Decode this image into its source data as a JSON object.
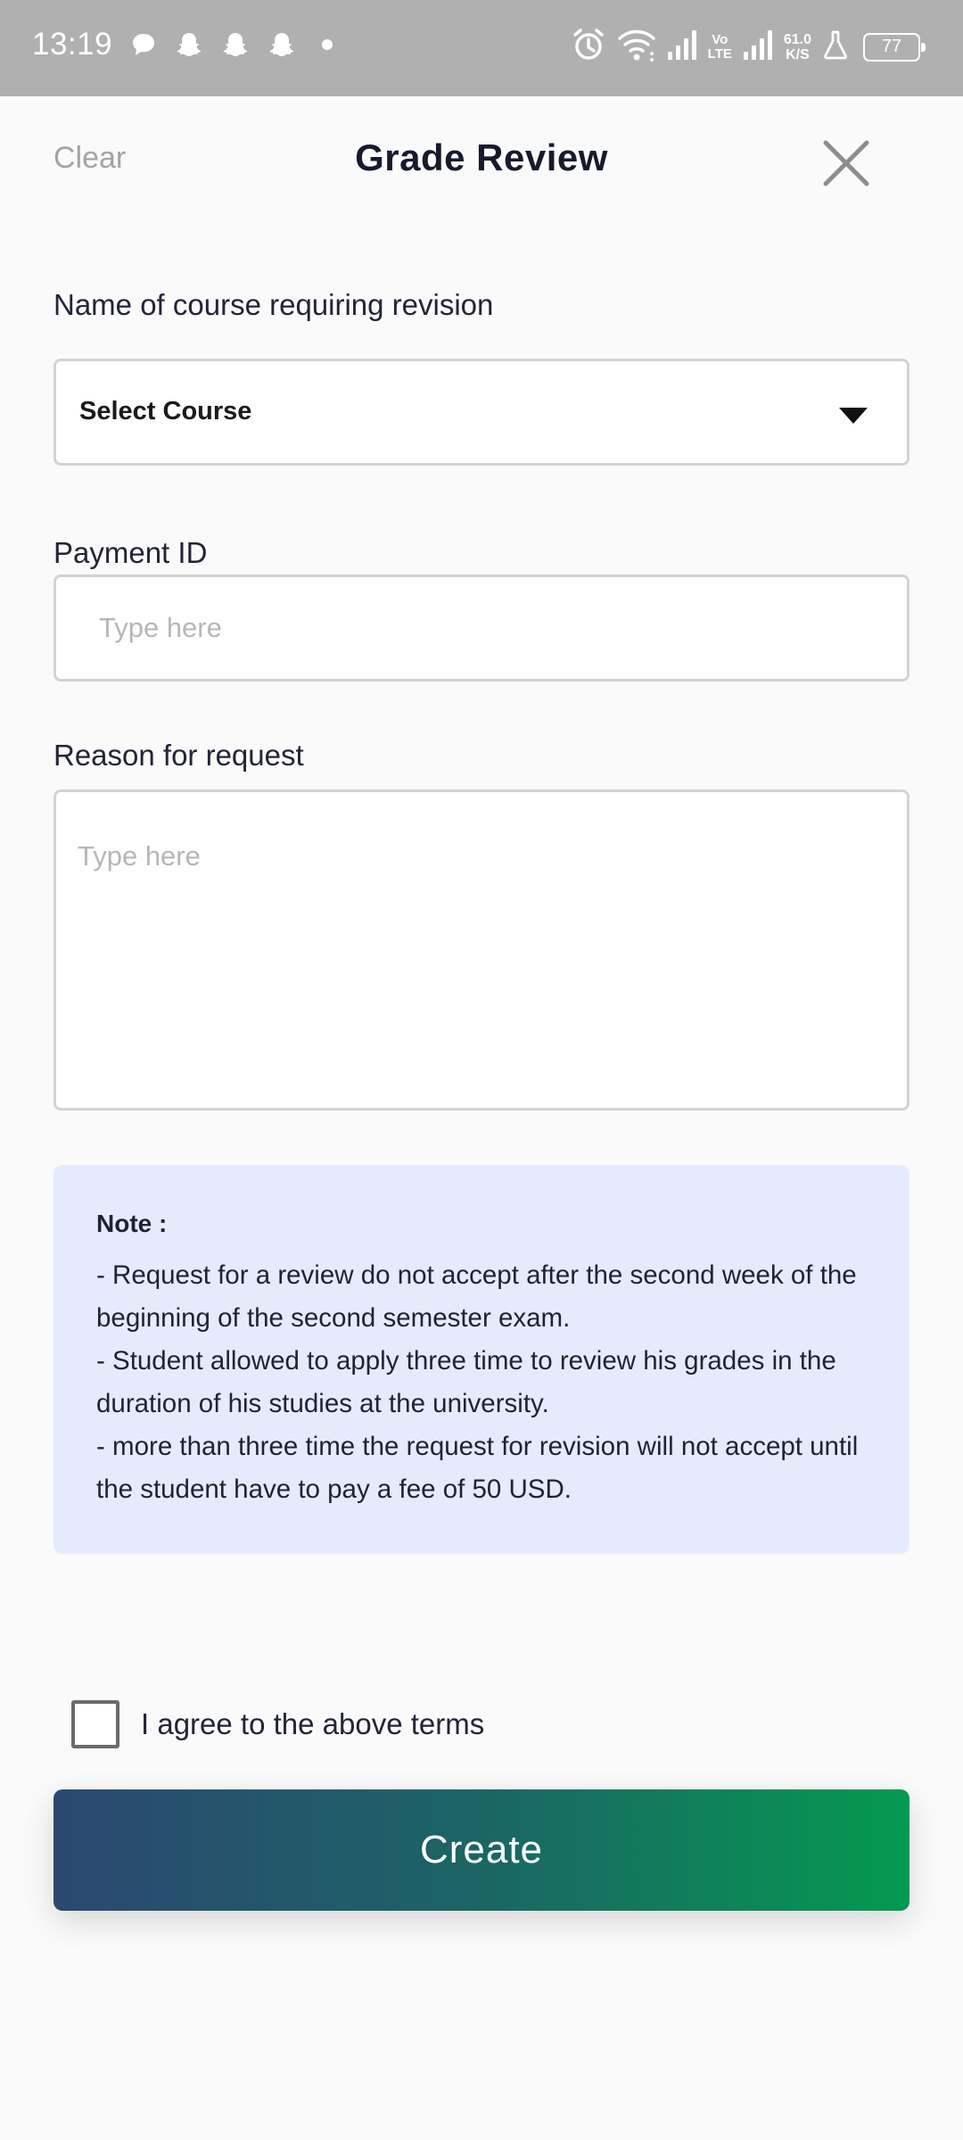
{
  "status_bar": {
    "time": "13:19",
    "left_icons": [
      "chat-bubble-icon",
      "snapchat-icon",
      "snapchat-icon",
      "snapchat-icon",
      "dot-icon"
    ],
    "lte_top": "Vo",
    "lte_bottom": "LTE",
    "net_speed_value": "61.0",
    "net_speed_unit": "K/S",
    "battery": "77"
  },
  "header": {
    "clear_label": "Clear",
    "title": "Grade Review",
    "close_icon": "close-icon"
  },
  "form": {
    "course_label": "Name of course requiring revision",
    "course_select_value": "Select Course",
    "payment_label": "Payment ID",
    "payment_placeholder": "Type here",
    "reason_label": "Reason for request",
    "reason_placeholder": "Type here"
  },
  "note": {
    "title": "Note :",
    "lines": [
      "- Request for a review do not accept after the second week of the beginning of the second semester exam.",
      "- Student allowed to apply three time to review his grades in the duration of his studies at the university.",
      "- more than three time the request for revision will not accept until the student have to pay a fee of 50 USD."
    ]
  },
  "agree_label": "I agree to the above terms",
  "agree_checked": false,
  "create_label": "Create",
  "colors": {
    "title": "#171a2c",
    "note_background": "#e6ebfc",
    "button_gradient_start": "#2b4871",
    "button_gradient_end": "#049a4f",
    "status_bar": "#b0b0b0"
  }
}
